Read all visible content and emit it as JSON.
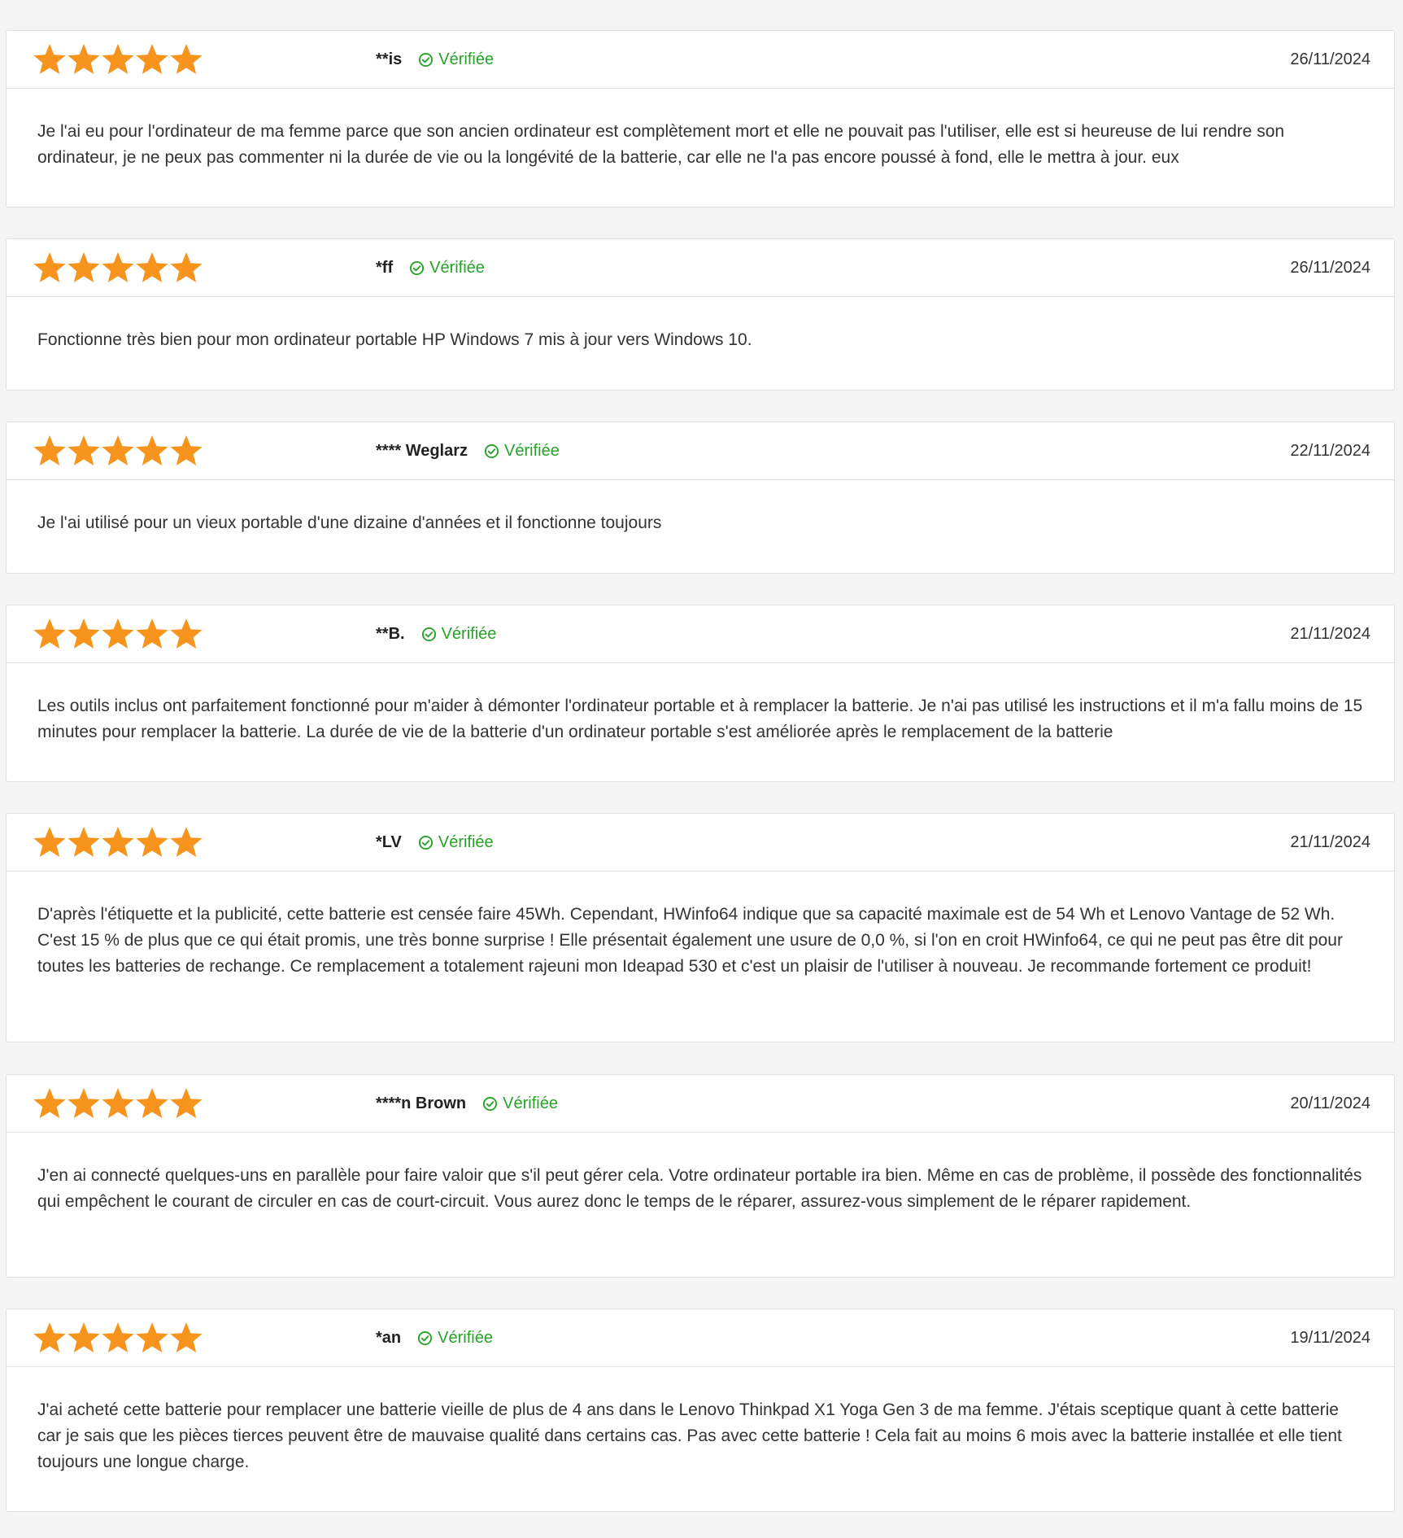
{
  "accent_star_color": "#f7941d",
  "verified_color": "#27a327",
  "reviews": [
    {
      "rating": 5,
      "author": "**is",
      "verified_label": "Vérifiée",
      "date": "26/11/2024",
      "text": "Je l'ai eu pour l'ordinateur de ma femme parce que son ancien ordinateur est complètement mort et elle ne pouvait pas l'utiliser, elle est si heureuse de lui rendre son ordinateur, je ne peux pas commenter ni la durée de vie ou la longévité de la batterie, car elle ne l'a pas encore poussé à fond, elle le mettra à jour. eux"
    },
    {
      "rating": 5,
      "author": "*ff",
      "verified_label": "Vérifiée",
      "date": "26/11/2024",
      "text": "Fonctionne très bien pour mon ordinateur portable HP Windows 7 mis à jour vers Windows 10."
    },
    {
      "rating": 5,
      "author": "**** Weglarz",
      "verified_label": "Vérifiée",
      "date": "22/11/2024",
      "text": "Je l'ai utilisé pour un vieux portable d'une dizaine d'années et il fonctionne toujours"
    },
    {
      "rating": 5,
      "author": "**B.",
      "verified_label": "Vérifiée",
      "date": "21/11/2024",
      "text": "Les outils inclus ont parfaitement fonctionné pour m'aider à démonter l'ordinateur portable et à remplacer la batterie. Je n'ai pas utilisé les instructions et il m'a fallu moins de 15 minutes pour remplacer la batterie. La durée de vie de la batterie d'un ordinateur portable s'est améliorée après le remplacement de la batterie"
    },
    {
      "rating": 5,
      "author": "*LV",
      "verified_label": "Vérifiée",
      "date": "21/11/2024",
      "text": "D'après l'étiquette et la publicité, cette batterie est censée faire 45Wh. Cependant, HWinfo64 indique que sa capacité maximale est de 54 Wh et Lenovo Vantage de 52 Wh. C'est 15 % de plus que ce qui était promis, une très bonne surprise ! Elle présentait également une usure de 0,0 %, si l'on en croit HWinfo64, ce qui ne peut pas être dit pour toutes les batteries de rechange. Ce remplacement a totalement rajeuni mon Ideapad 530 et c'est un plaisir de l'utiliser à nouveau. Je recommande fortement ce produit!"
    },
    {
      "rating": 5,
      "author": "****n Brown",
      "verified_label": "Vérifiée",
      "date": "20/11/2024",
      "text": "J'en ai connecté quelques-uns en parallèle pour faire valoir que s'il peut gérer cela. Votre ordinateur portable ira bien. Même en cas de problème, il possède des fonctionnalités qui empêchent le courant de circuler en cas de court-circuit. Vous aurez donc le temps de le réparer, assurez-vous simplement de le réparer rapidement."
    },
    {
      "rating": 5,
      "author": "*an",
      "verified_label": "Vérifiée",
      "date": "19/11/2024",
      "text": "J'ai acheté cette batterie pour remplacer une batterie vieille de plus de 4 ans dans le Lenovo Thinkpad X1 Yoga Gen 3 de ma femme. J'étais sceptique quant à cette batterie car je sais que les pièces tierces peuvent être de mauvaise qualité dans certains cas. Pas avec cette batterie ! Cela fait au moins 6 mois avec la batterie installée et elle tient toujours une longue charge."
    }
  ]
}
